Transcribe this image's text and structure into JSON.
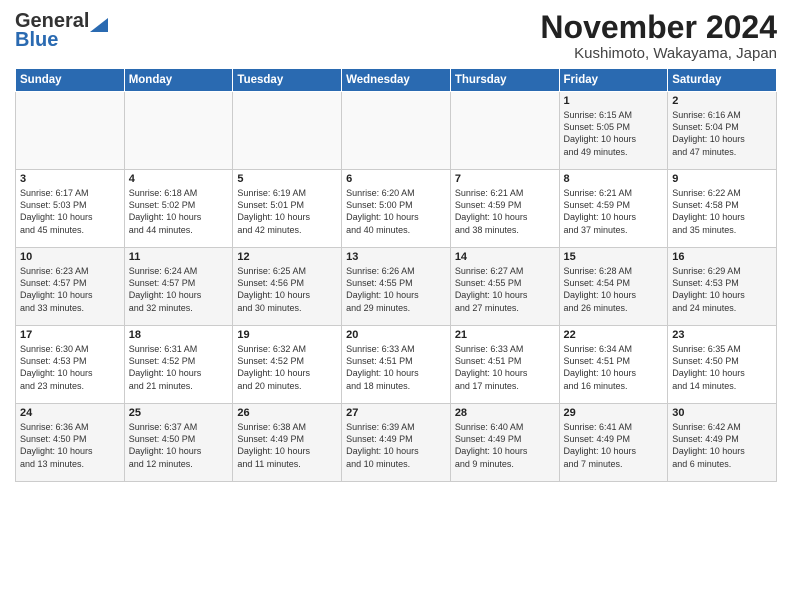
{
  "header": {
    "logo_general": "General",
    "logo_blue": "Blue",
    "month_title": "November 2024",
    "location": "Kushimoto, Wakayama, Japan"
  },
  "days_of_week": [
    "Sunday",
    "Monday",
    "Tuesday",
    "Wednesday",
    "Thursday",
    "Friday",
    "Saturday"
  ],
  "weeks": [
    [
      {
        "day": "",
        "text": ""
      },
      {
        "day": "",
        "text": ""
      },
      {
        "day": "",
        "text": ""
      },
      {
        "day": "",
        "text": ""
      },
      {
        "day": "",
        "text": ""
      },
      {
        "day": "1",
        "text": "Sunrise: 6:15 AM\nSunset: 5:05 PM\nDaylight: 10 hours\nand 49 minutes."
      },
      {
        "day": "2",
        "text": "Sunrise: 6:16 AM\nSunset: 5:04 PM\nDaylight: 10 hours\nand 47 minutes."
      }
    ],
    [
      {
        "day": "3",
        "text": "Sunrise: 6:17 AM\nSunset: 5:03 PM\nDaylight: 10 hours\nand 45 minutes."
      },
      {
        "day": "4",
        "text": "Sunrise: 6:18 AM\nSunset: 5:02 PM\nDaylight: 10 hours\nand 44 minutes."
      },
      {
        "day": "5",
        "text": "Sunrise: 6:19 AM\nSunset: 5:01 PM\nDaylight: 10 hours\nand 42 minutes."
      },
      {
        "day": "6",
        "text": "Sunrise: 6:20 AM\nSunset: 5:00 PM\nDaylight: 10 hours\nand 40 minutes."
      },
      {
        "day": "7",
        "text": "Sunrise: 6:21 AM\nSunset: 4:59 PM\nDaylight: 10 hours\nand 38 minutes."
      },
      {
        "day": "8",
        "text": "Sunrise: 6:21 AM\nSunset: 4:59 PM\nDaylight: 10 hours\nand 37 minutes."
      },
      {
        "day": "9",
        "text": "Sunrise: 6:22 AM\nSunset: 4:58 PM\nDaylight: 10 hours\nand 35 minutes."
      }
    ],
    [
      {
        "day": "10",
        "text": "Sunrise: 6:23 AM\nSunset: 4:57 PM\nDaylight: 10 hours\nand 33 minutes."
      },
      {
        "day": "11",
        "text": "Sunrise: 6:24 AM\nSunset: 4:57 PM\nDaylight: 10 hours\nand 32 minutes."
      },
      {
        "day": "12",
        "text": "Sunrise: 6:25 AM\nSunset: 4:56 PM\nDaylight: 10 hours\nand 30 minutes."
      },
      {
        "day": "13",
        "text": "Sunrise: 6:26 AM\nSunset: 4:55 PM\nDaylight: 10 hours\nand 29 minutes."
      },
      {
        "day": "14",
        "text": "Sunrise: 6:27 AM\nSunset: 4:55 PM\nDaylight: 10 hours\nand 27 minutes."
      },
      {
        "day": "15",
        "text": "Sunrise: 6:28 AM\nSunset: 4:54 PM\nDaylight: 10 hours\nand 26 minutes."
      },
      {
        "day": "16",
        "text": "Sunrise: 6:29 AM\nSunset: 4:53 PM\nDaylight: 10 hours\nand 24 minutes."
      }
    ],
    [
      {
        "day": "17",
        "text": "Sunrise: 6:30 AM\nSunset: 4:53 PM\nDaylight: 10 hours\nand 23 minutes."
      },
      {
        "day": "18",
        "text": "Sunrise: 6:31 AM\nSunset: 4:52 PM\nDaylight: 10 hours\nand 21 minutes."
      },
      {
        "day": "19",
        "text": "Sunrise: 6:32 AM\nSunset: 4:52 PM\nDaylight: 10 hours\nand 20 minutes."
      },
      {
        "day": "20",
        "text": "Sunrise: 6:33 AM\nSunset: 4:51 PM\nDaylight: 10 hours\nand 18 minutes."
      },
      {
        "day": "21",
        "text": "Sunrise: 6:33 AM\nSunset: 4:51 PM\nDaylight: 10 hours\nand 17 minutes."
      },
      {
        "day": "22",
        "text": "Sunrise: 6:34 AM\nSunset: 4:51 PM\nDaylight: 10 hours\nand 16 minutes."
      },
      {
        "day": "23",
        "text": "Sunrise: 6:35 AM\nSunset: 4:50 PM\nDaylight: 10 hours\nand 14 minutes."
      }
    ],
    [
      {
        "day": "24",
        "text": "Sunrise: 6:36 AM\nSunset: 4:50 PM\nDaylight: 10 hours\nand 13 minutes."
      },
      {
        "day": "25",
        "text": "Sunrise: 6:37 AM\nSunset: 4:50 PM\nDaylight: 10 hours\nand 12 minutes."
      },
      {
        "day": "26",
        "text": "Sunrise: 6:38 AM\nSunset: 4:49 PM\nDaylight: 10 hours\nand 11 minutes."
      },
      {
        "day": "27",
        "text": "Sunrise: 6:39 AM\nSunset: 4:49 PM\nDaylight: 10 hours\nand 10 minutes."
      },
      {
        "day": "28",
        "text": "Sunrise: 6:40 AM\nSunset: 4:49 PM\nDaylight: 10 hours\nand 9 minutes."
      },
      {
        "day": "29",
        "text": "Sunrise: 6:41 AM\nSunset: 4:49 PM\nDaylight: 10 hours\nand 7 minutes."
      },
      {
        "day": "30",
        "text": "Sunrise: 6:42 AM\nSunset: 4:49 PM\nDaylight: 10 hours\nand 6 minutes."
      }
    ]
  ]
}
